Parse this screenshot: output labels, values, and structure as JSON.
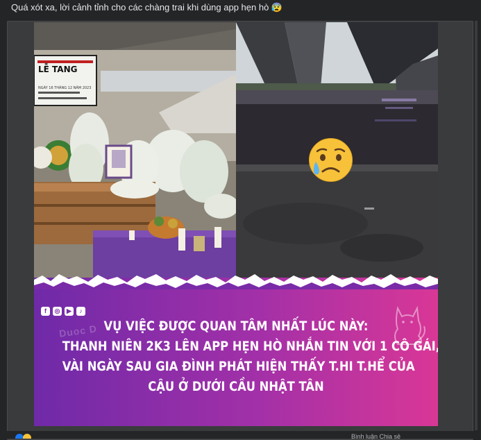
{
  "post": {
    "caption": "Quá xót xa, lời cảnh tỉnh cho các chàng trai khi dùng app hẹn hò 😰"
  },
  "image": {
    "sign_text": "LỄ TANG",
    "sign_small_1": "NGÀY 16 THÁNG 12 NĂM 2023",
    "watermark": "Duoc D",
    "emoji_icon": "sad-relieved-face-icon",
    "headline": [
      "VỤ VIỆC ĐƯỢC QUAN TÂM NHẤT LÚC NÀY:",
      "THANH NIÊN 2K3 LÊN APP HẸN HÒ NHẮN TIN VỚI 1 CÔ GÁI,",
      "VÀI NGÀY SAU GIA ĐÌNH PHÁT HIỆN THẤY T.HI T.HỂ CỦA",
      "CẬU Ở DƯỚI CẦU NHẬT TÂN"
    ],
    "social_icons": [
      "facebook-icon",
      "instagram-icon",
      "youtube-icon",
      "tiktok-icon"
    ],
    "social_glyphs": [
      "f",
      "◎",
      "▶",
      "♪"
    ],
    "banner_colors": [
      "#6f2aa8",
      "#d93796"
    ]
  },
  "footer": {
    "partial_text": "Bình luận   Chia sẻ"
  }
}
